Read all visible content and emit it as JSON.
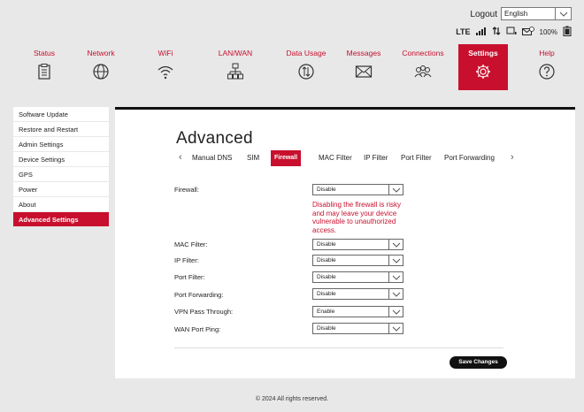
{
  "header": {
    "logout_label": "Logout",
    "language_selected": "English",
    "network_type": "LTE",
    "battery_text": "100%"
  },
  "nav": {
    "items": [
      {
        "label": "Status",
        "icon": "clipboard-icon"
      },
      {
        "label": "Network",
        "icon": "globe-icon"
      },
      {
        "label": "WiFi",
        "icon": "wifi-icon"
      },
      {
        "label": "LAN/WAN",
        "icon": "network-tree-icon"
      },
      {
        "label": "Data Usage",
        "icon": "data-usage-icon"
      },
      {
        "label": "Messages",
        "icon": "envelope-icon"
      },
      {
        "label": "Connections",
        "icon": "users-icon"
      },
      {
        "label": "Settings",
        "icon": "gear-icon"
      },
      {
        "label": "Help",
        "icon": "help-icon"
      }
    ],
    "active": "Settings"
  },
  "sidebar": {
    "items": [
      {
        "label": "Software Update"
      },
      {
        "label": "Restore and Restart"
      },
      {
        "label": "Admin Settings"
      },
      {
        "label": "Device Settings"
      },
      {
        "label": "GPS"
      },
      {
        "label": "Power"
      },
      {
        "label": "About"
      },
      {
        "label": "Advanced Settings"
      }
    ],
    "active": "Advanced Settings"
  },
  "main": {
    "title": "Advanced",
    "tabs": [
      {
        "label": "Manual DNS"
      },
      {
        "label": "SIM"
      },
      {
        "label": "Firewall"
      },
      {
        "label": "MAC Filter"
      },
      {
        "label": "IP Filter"
      },
      {
        "label": "Port Filter"
      },
      {
        "label": "Port Forwarding"
      }
    ],
    "active_tab": "Firewall",
    "fields": [
      {
        "label": "Firewall:",
        "value": "Disable"
      },
      {
        "label": "MAC Filter:",
        "value": "Disable"
      },
      {
        "label": "IP Filter:",
        "value": "Disable"
      },
      {
        "label": "Port Filter:",
        "value": "Disable"
      },
      {
        "label": "Port Forwarding:",
        "value": "Disable"
      },
      {
        "label": "VPN Pass Through:",
        "value": "Enable"
      },
      {
        "label": "WAN Port Ping:",
        "value": "Disable"
      }
    ],
    "warning": "Disabling the firewall is risky and may leave your device vulnerable to unauthorized access.",
    "save_label": "Save Changes"
  },
  "footer": {
    "text": "© 2024 All rights reserved."
  },
  "colors": {
    "accent": "#c8102e",
    "background": "#e8e8e8",
    "panel": "#ffffff",
    "button": "#111111"
  }
}
